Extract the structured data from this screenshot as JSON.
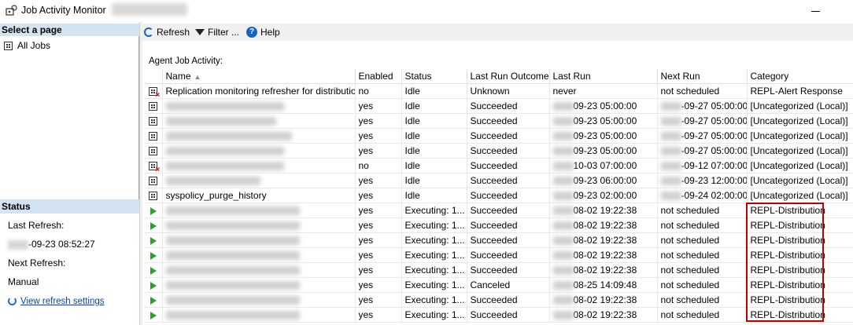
{
  "window": {
    "title": "Job Activity Monitor"
  },
  "left_pane": {
    "select_page_header": "Select a page",
    "pages": [
      {
        "label": "All Jobs",
        "icon": "grid-icon"
      }
    ],
    "status_header": "Status",
    "last_refresh_label": "Last Refresh:",
    "last_refresh_value": "-09-23 08:52:27",
    "next_refresh_label": "Next Refresh:",
    "next_refresh_value": "Manual",
    "view_refresh_settings": "View refresh settings"
  },
  "toolbar": {
    "refresh_label": "Refresh",
    "filter_label": "Filter ...",
    "help_label": "Help"
  },
  "section_label": "Agent Job Activity:",
  "table": {
    "columns": [
      "Name",
      "Enabled",
      "Status",
      "Last Run Outcome",
      "Last Run",
      "Next Run",
      "Category"
    ],
    "rows": [
      {
        "icon": "job-icon-disabled",
        "name": "Replication monitoring refresher for distribution.",
        "enabled": "no",
        "status": "Idle",
        "outcome": "Unknown",
        "last_run": "never",
        "next_run": "not scheduled",
        "category": "REPL-Alert Response"
      },
      {
        "icon": "job-icon",
        "name": "",
        "enabled": "yes",
        "status": "Idle",
        "outcome": "Succeeded",
        "last_run": "09-23 05:00:00",
        "next_run": "-09-27 05:00:00",
        "category": "[Uncategorized (Local)]"
      },
      {
        "icon": "job-icon",
        "name": "",
        "enabled": "yes",
        "status": "Idle",
        "outcome": "Succeeded",
        "last_run": "09-23 05:00:00",
        "next_run": "-09-27 05:00:00",
        "category": "[Uncategorized (Local)]"
      },
      {
        "icon": "job-icon",
        "name": "",
        "enabled": "yes",
        "status": "Idle",
        "outcome": "Succeeded",
        "last_run": "09-23 05:00:00",
        "next_run": "-09-27 05:00:00",
        "category": "[Uncategorized (Local)]"
      },
      {
        "icon": "job-icon",
        "name": "",
        "enabled": "yes",
        "status": "Idle",
        "outcome": "Succeeded",
        "last_run": "09-23 05:00:00",
        "next_run": "-09-27 05:00:00",
        "category": "[Uncategorized (Local)]"
      },
      {
        "icon": "job-icon-disabled",
        "name": "",
        "enabled": "no",
        "status": "Idle",
        "outcome": "Succeeded",
        "last_run": "10-03 07:00:00",
        "next_run": "-09-12 07:00:00",
        "category": "[Uncategorized (Local)]"
      },
      {
        "icon": "job-icon",
        "name": "",
        "enabled": "yes",
        "status": "Idle",
        "outcome": "Succeeded",
        "last_run": "09-23 06:00:00",
        "next_run": "-09-23 12:00:00",
        "category": "[Uncategorized (Local)]"
      },
      {
        "icon": "job-icon",
        "name": "syspolicy_purge_history",
        "enabled": "yes",
        "status": "Idle",
        "outcome": "Succeeded",
        "last_run": "09-23 02:00:00",
        "next_run": "-09-24 02:00:00",
        "category": "[Uncategorized (Local)]"
      },
      {
        "icon": "play-icon",
        "name": "",
        "enabled": "yes",
        "status": "Executing: 1...",
        "outcome": "Succeeded",
        "last_run": "08-02 19:22:38",
        "next_run": "not scheduled",
        "category": "REPL-Distribution"
      },
      {
        "icon": "play-icon",
        "name": "",
        "enabled": "yes",
        "status": "Executing: 1...",
        "outcome": "Succeeded",
        "last_run": "08-02 19:22:38",
        "next_run": "not scheduled",
        "category": "REPL-Distribution"
      },
      {
        "icon": "play-icon",
        "name": "",
        "enabled": "yes",
        "status": "Executing: 1...",
        "outcome": "Succeeded",
        "last_run": "08-02 19:22:38",
        "next_run": "not scheduled",
        "category": "REPL-Distribution"
      },
      {
        "icon": "play-icon",
        "name": "",
        "enabled": "yes",
        "status": "Executing: 1...",
        "outcome": "Succeeded",
        "last_run": "08-02 19:22:38",
        "next_run": "not scheduled",
        "category": "REPL-Distribution"
      },
      {
        "icon": "play-icon",
        "name": "",
        "enabled": "yes",
        "status": "Executing: 1...",
        "outcome": "Succeeded",
        "last_run": "08-02 19:22:38",
        "next_run": "not scheduled",
        "category": "REPL-Distribution"
      },
      {
        "icon": "play-icon",
        "name": "",
        "enabled": "yes",
        "status": "Executing: 1...",
        "outcome": "Canceled",
        "last_run": "08-25 14:09:48",
        "next_run": "not scheduled",
        "category": "REPL-Distribution"
      },
      {
        "icon": "play-icon",
        "name": "",
        "enabled": "yes",
        "status": "Executing: 1...",
        "outcome": "Succeeded",
        "last_run": "08-02 19:22:38",
        "next_run": "not scheduled",
        "category": "REPL-Distribution"
      },
      {
        "icon": "play-icon",
        "name": "",
        "enabled": "yes",
        "status": "Executing: 1...",
        "outcome": "Succeeded",
        "last_run": "08-02 19:22:38",
        "next_run": "not scheduled",
        "category": "REPL-Distribution"
      }
    ]
  },
  "colors": {
    "header_bg": "#d4e3f2",
    "highlight_border": "#c00000",
    "running_icon": "#2ca02c",
    "link": "#0645ad"
  }
}
